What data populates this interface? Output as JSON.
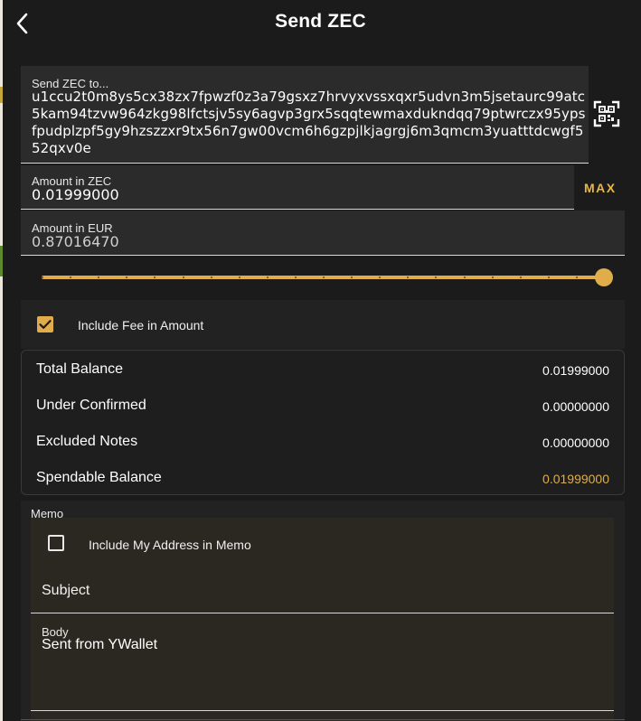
{
  "header": {
    "title": "Send ZEC"
  },
  "address": {
    "label": "Send ZEC to...",
    "value": "u1ccu2t0m8ys5cx38zx7fpwzf0z3a79gsxz7hrvyxvssxqxr5udvn3m5jsetaurc99atc5kam94tzvw964zkg98lfctsjv5sy6agvp3grx5sqqtewmaxdukndqq79ptwrczx95ypsfpudplzpf5gy9hzszzxr9tx56n7gw00vcm6h6gzpjlkjagrgj6m3qmcm3yuatttdcwgf552qxv0e"
  },
  "amount": {
    "label": "Amount in ZEC",
    "value": "0.01999000",
    "max_label": "MAX"
  },
  "fiat": {
    "label": "Amount in EUR",
    "value": "0.87016470"
  },
  "slider": {
    "fraction": 1.0,
    "ticks": 21
  },
  "fee": {
    "label": "Include Fee in Amount",
    "checked": true
  },
  "balance": {
    "rows": [
      {
        "label": "Total Balance",
        "value": "0.01999000"
      },
      {
        "label": "Under Confirmed",
        "value": "0.00000000"
      },
      {
        "label": "Excluded Notes",
        "value": "0.00000000"
      },
      {
        "label": "Spendable Balance",
        "value": "0.01999000"
      }
    ]
  },
  "memo": {
    "title": "Memo",
    "include_address_label": "Include My Address in Memo",
    "include_address_checked": false,
    "subject_placeholder": "Subject",
    "body_label": "Body",
    "body_value": "Sent from YWallet"
  },
  "colors": {
    "accent": "#e0ad4a",
    "background": "#1b1b1b",
    "field": "#2b2b2b"
  },
  "icons": {
    "back": "back-arrow-icon",
    "qr": "qr-scan-icon",
    "check": "checkmark-icon"
  }
}
